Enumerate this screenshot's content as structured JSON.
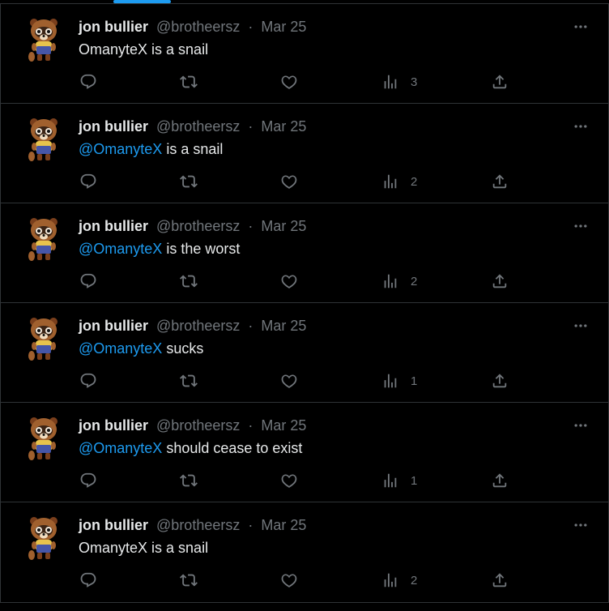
{
  "feed": {
    "tweets": [
      {
        "name": "jon bullier",
        "handle": "@brotheersz",
        "separator": "·",
        "date": "Mar 25",
        "mention": "",
        "text": "OmanyteX is a snail",
        "views": "3"
      },
      {
        "name": "jon bullier",
        "handle": "@brotheersz",
        "separator": "·",
        "date": "Mar 25",
        "mention": "@OmanyteX",
        "text": " is a snail",
        "views": "2"
      },
      {
        "name": "jon bullier",
        "handle": "@brotheersz",
        "separator": "·",
        "date": "Mar 25",
        "mention": "@OmanyteX",
        "text": " is the worst",
        "views": "2"
      },
      {
        "name": "jon bullier",
        "handle": "@brotheersz",
        "separator": "·",
        "date": "Mar 25",
        "mention": "@OmanyteX",
        "text": " sucks",
        "views": "1"
      },
      {
        "name": "jon bullier",
        "handle": "@brotheersz",
        "separator": "·",
        "date": "Mar 25",
        "mention": "@OmanyteX",
        "text": " should cease to exist",
        "views": "1"
      },
      {
        "name": "jon bullier",
        "handle": "@brotheersz",
        "separator": "·",
        "date": "Mar 25",
        "mention": "",
        "text": "OmanyteX is a snail",
        "views": "2"
      }
    ]
  },
  "icons": {
    "more": "more-horizontal-icon",
    "reply": "reply-bubble-icon",
    "retweet": "retweet-arrows-icon",
    "like": "heart-icon",
    "views": "views-bar-chart-icon",
    "share": "share-upload-icon",
    "avatar": "tanuki-avatar"
  },
  "colors": {
    "background": "#000000",
    "text": "#e7e9ea",
    "muted": "#71767b",
    "accent": "#1d9bf0",
    "divider": "#2f3336"
  }
}
